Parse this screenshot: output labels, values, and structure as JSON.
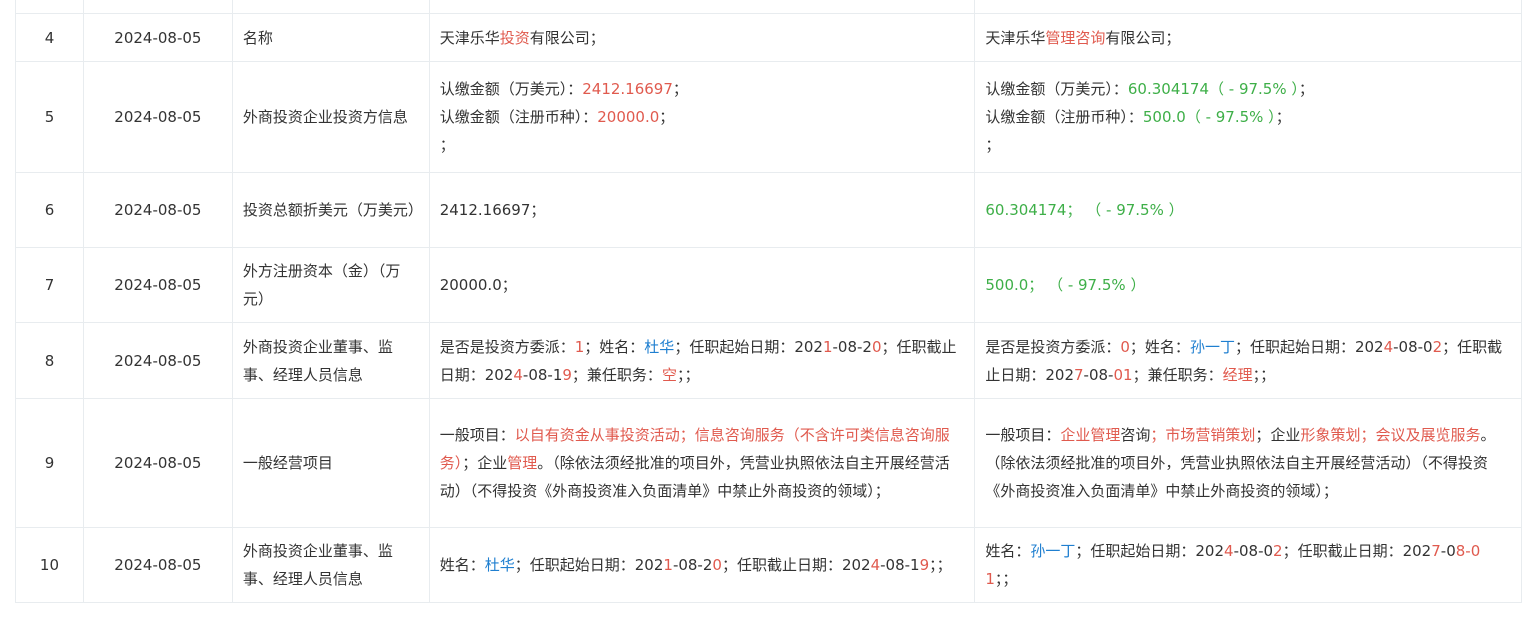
{
  "rows": [
    {
      "no": "4",
      "date": "2024-08-05",
      "item": "名称",
      "before": [
        {
          "t": "天津乐华"
        },
        {
          "t": "投资",
          "c": "r"
        },
        {
          "t": "有限公司；"
        }
      ],
      "after": [
        {
          "t": "天津乐华"
        },
        {
          "t": "管理咨询",
          "c": "r"
        },
        {
          "t": "有限公司；"
        }
      ]
    },
    {
      "no": "5",
      "date": "2024-08-05",
      "item": "外商投资企业投资方信息",
      "before": [
        {
          "t": "认缴金额（万美元）："
        },
        {
          "t": "2412.16697",
          "c": "r"
        },
        {
          "t": "；"
        },
        {
          "br": true
        },
        {
          "t": "认缴金额（注册币种）："
        },
        {
          "t": "20000.0",
          "c": "r"
        },
        {
          "t": "；"
        },
        {
          "br": true
        },
        {
          "t": "；"
        }
      ],
      "after": [
        {
          "t": "认缴金额（万美元）："
        },
        {
          "t": "60.304174（ - 97.5% ）",
          "c": "g"
        },
        {
          "t": "；"
        },
        {
          "br": true
        },
        {
          "t": "认缴金额（注册币种）："
        },
        {
          "t": "500.0（ - 97.5% ）",
          "c": "g"
        },
        {
          "t": "；"
        },
        {
          "br": true
        },
        {
          "t": "；"
        }
      ]
    },
    {
      "no": "6",
      "date": "2024-08-05",
      "item": "投资总额折美元（万美元）",
      "before": [
        {
          "t": "2412.16697；"
        }
      ],
      "after": [
        {
          "t": "60.304174；  （ - 97.5% ）",
          "c": "g"
        }
      ]
    },
    {
      "no": "7",
      "date": "2024-08-05",
      "item": "外方注册资本（金）（万元）",
      "before": [
        {
          "t": "20000.0；"
        }
      ],
      "after": [
        {
          "t": "500.0；  （ - 97.5% ）",
          "c": "g"
        }
      ]
    },
    {
      "no": "8",
      "date": "2024-08-05",
      "item": "外商投资企业董事、监事、经理人员信息",
      "before": [
        {
          "t": "是否是投资方委派："
        },
        {
          "t": "1",
          "c": "r"
        },
        {
          "t": "；姓名："
        },
        {
          "t": "杜华",
          "c": "b"
        },
        {
          "t": "；任职起始日期：202"
        },
        {
          "t": "1",
          "c": "r"
        },
        {
          "t": "-08-2"
        },
        {
          "t": "0",
          "c": "r"
        },
        {
          "t": "；任职截止日期：202"
        },
        {
          "t": "4",
          "c": "r"
        },
        {
          "t": "-08-1"
        },
        {
          "t": "9",
          "c": "r"
        },
        {
          "t": "；兼任职务："
        },
        {
          "t": "空",
          "c": "r"
        },
        {
          "t": "；；"
        }
      ],
      "after": [
        {
          "t": "是否是投资方委派："
        },
        {
          "t": "0",
          "c": "r"
        },
        {
          "t": "；姓名："
        },
        {
          "t": "孙一丁",
          "c": "b"
        },
        {
          "t": "；任职起始日期：202"
        },
        {
          "t": "4",
          "c": "r"
        },
        {
          "t": "-08-0"
        },
        {
          "t": "2",
          "c": "r"
        },
        {
          "t": "；任职截止日期：202"
        },
        {
          "t": "7",
          "c": "r"
        },
        {
          "t": "-08-"
        },
        {
          "t": "01",
          "c": "r"
        },
        {
          "t": "；兼任职务："
        },
        {
          "t": "经理",
          "c": "r"
        },
        {
          "t": "；；"
        }
      ]
    },
    {
      "no": "9",
      "date": "2024-08-05",
      "item": "一般经营项目",
      "before": [
        {
          "t": "一般项目："
        },
        {
          "t": "以自有资金从事投资活动；信息咨询服务（不含许可类信息咨询服务）",
          "c": "r"
        },
        {
          "t": "；企业"
        },
        {
          "t": "管理",
          "c": "r"
        },
        {
          "t": "。（除依法须经批准的项目外，凭营业执照依法自主开展经营活动）（不得投资《外商投资准入负面清单》中禁止外商投资的领域）；"
        }
      ],
      "after": [
        {
          "t": "一般项目："
        },
        {
          "t": "企业管理",
          "c": "r"
        },
        {
          "t": "咨询"
        },
        {
          "t": "；市场营销策划",
          "c": "r"
        },
        {
          "t": "；企业"
        },
        {
          "t": "形象策划；会议及展览服务",
          "c": "r"
        },
        {
          "t": "。（除依法须经批准的项目外，凭营业执照依法自主开展经营活动）（不得投资《外商投资准入负面清单》中禁止外商投资的领域）；"
        }
      ]
    },
    {
      "no": "10",
      "date": "2024-08-05",
      "item": "外商投资企业董事、监事、经理人员信息",
      "before": [
        {
          "t": "姓名："
        },
        {
          "t": "杜华",
          "c": "b"
        },
        {
          "t": "；任职起始日期：202"
        },
        {
          "t": "1",
          "c": "r"
        },
        {
          "t": "-08-2"
        },
        {
          "t": "0",
          "c": "r"
        },
        {
          "t": "；任职截止日期：202"
        },
        {
          "t": "4",
          "c": "r"
        },
        {
          "t": "-08-1"
        },
        {
          "t": "9",
          "c": "r"
        },
        {
          "t": "；；"
        }
      ],
      "after": [
        {
          "t": "姓名："
        },
        {
          "t": "孙一丁",
          "c": "b"
        },
        {
          "t": "；任职起始日期：202"
        },
        {
          "t": "4",
          "c": "r"
        },
        {
          "t": "-08-0"
        },
        {
          "t": "2",
          "c": "r"
        },
        {
          "t": "；任职截止日期：202"
        },
        {
          "t": "7",
          "c": "r"
        },
        {
          "t": "-0"
        },
        {
          "t": "8-01",
          "c": "r"
        },
        {
          "t": "；；"
        }
      ]
    }
  ],
  "colors": {
    "changed_red": "#e05a4e",
    "person_blue": "#1f7fd0",
    "decrease_green": "#3eaf48",
    "border": "#e8ecef",
    "text": "#333333"
  }
}
